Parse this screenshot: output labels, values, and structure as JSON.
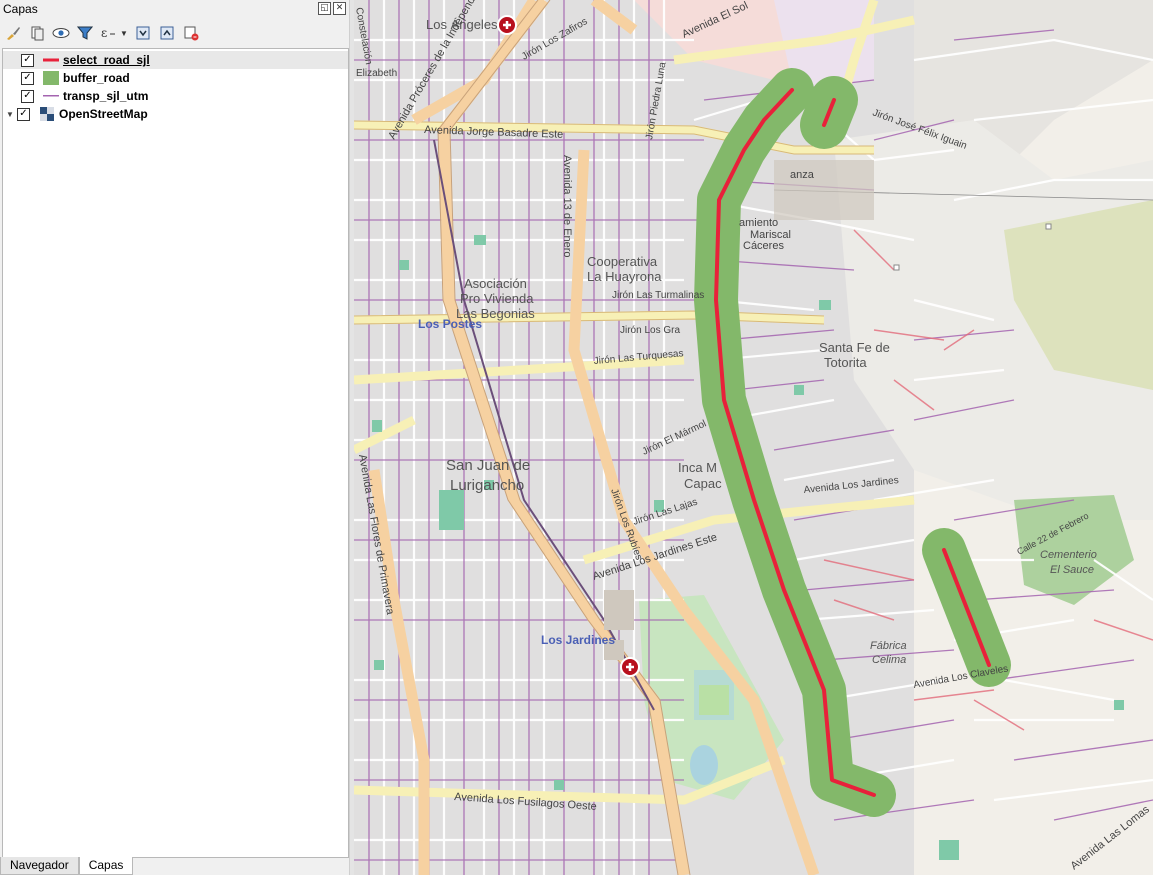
{
  "panel": {
    "title": "Capas",
    "buttons": [
      "float-icon",
      "close-icon"
    ]
  },
  "toolbar": {
    "tools": [
      "style-brush-icon",
      "add-group-icon",
      "visibility-eye-icon",
      "filter-icon",
      "expression-filter-icon",
      "expand-all-icon",
      "collapse-all-icon",
      "remove-layer-icon"
    ]
  },
  "layers": [
    {
      "name": "select_road_sjl",
      "checked": true,
      "symbol": "line",
      "color": "#e8213a",
      "selected": true
    },
    {
      "name": "buffer_road",
      "checked": true,
      "symbol": "fill",
      "color": "#83b86a"
    },
    {
      "name": "transp_sjl_utm",
      "checked": true,
      "symbol": "line",
      "color": "#a464b0"
    },
    {
      "name": "OpenStreetMap",
      "checked": true,
      "symbol": "raster",
      "expandable": true
    }
  ],
  "tabs": [
    {
      "label": "Navegador",
      "active": false
    },
    {
      "label": "Capas",
      "active": true
    }
  ],
  "map": {
    "colors": {
      "background": "#f2efe9",
      "road_line": "#e8213a",
      "buffer": "#83b86a",
      "transit": "#a464b0",
      "park": "#c8e5c0"
    },
    "labels": {
      "los_angeles": "Los Ángeles",
      "av_el_sol": "Avenida El Sol",
      "av_jorge_basadre": "Avenida Jorge Basadre Este",
      "av_proceres": "Avenida Próceres de la Independencia",
      "los_postes": "Los Postes",
      "asociacion": "Asociación",
      "pro_vivienda": "Pro Vivienda",
      "las_begonias": "Las Begonias",
      "cooperativa": "Cooperativa",
      "la_huayrona": "La Huayrona",
      "av_13_enero": "Avenida 13 de Enero",
      "sjl_1": "San Juan de",
      "sjl_2": "Lurigancho",
      "av_jardines": "Avenida Los Jardines Este",
      "los_jardines": "Los Jardines",
      "av_flores": "Avenida Las Flores de Primavera",
      "av_fusilagos": "Avenida Los Fusilagos Oeste",
      "santa_fe_1": "Santa Fe de",
      "santa_fe_2": "Totorita",
      "inca_1": "Inca M",
      "inca_2": "Capac",
      "fabrica_1": "Fábrica",
      "fabrica_2": "Celima",
      "cementerio_1": "Cementerio",
      "cementerio_2": "El Sauce",
      "calle_febrero": "Calle 22 de Febrero",
      "av_las_lomas": "Avenida Las Lomas",
      "jr_los_zafiros": "Jirón Los Zafiros",
      "jr_piedra_luna": "Jirón Piedra Luna",
      "jr_jose_felix": "Jirón José Félix Iguain",
      "jr_los_rubies": "Jirón Los Rubíes",
      "jr_las_lajas": "Jirón Las Lajas",
      "jr_el_marmol": "Jirón El Mármol",
      "jr_las_turquesas": "Jirón Las Turquesas",
      "jr_los_granates": "Jirón Los Gra",
      "av_los_claveles": "Avenida Los Claveles",
      "av_jardines_2": "Avenida Los Jardines",
      "av_1": "Avenida",
      "jirones_misc": "Jirón Las Turmalinas",
      "ramiento": "amiento",
      "mariscal": "Mariscal",
      "caceres": "Cáceres",
      "zapanza": "anza",
      "constel": "Constelación",
      "elizabeth": "Elizabeth"
    }
  }
}
